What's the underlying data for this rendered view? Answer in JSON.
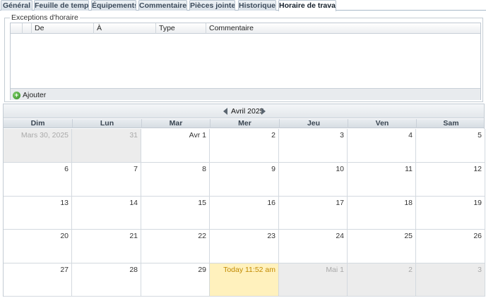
{
  "tabs": [
    {
      "label": "Général",
      "active": false
    },
    {
      "label": "Feuille de temps",
      "active": false
    },
    {
      "label": "Équipements",
      "active": false
    },
    {
      "label": "Commentaires",
      "active": false
    },
    {
      "label": "Pièces jointes",
      "active": false
    },
    {
      "label": "Historique",
      "active": false
    },
    {
      "label": "Horaire de travail",
      "active": true
    }
  ],
  "exceptions": {
    "legend": "Exceptions d'horaire",
    "columns": [
      "De",
      "À",
      "Type",
      "Commentaire"
    ],
    "rows": [],
    "add_label": "Ajouter",
    "add_icon": "add-icon"
  },
  "calendar": {
    "month_label": "Avril 2025",
    "weekdays": [
      "Dim",
      "Lun",
      "Mar",
      "Mer",
      "Jeu",
      "Ven",
      "Sam"
    ],
    "weeks": [
      [
        {
          "label": "Mars 30, 2025",
          "other": true
        },
        {
          "label": "31",
          "other": true
        },
        {
          "label": "Avr 1"
        },
        {
          "label": "2"
        },
        {
          "label": "3"
        },
        {
          "label": "4"
        },
        {
          "label": "5"
        }
      ],
      [
        {
          "label": "6"
        },
        {
          "label": "7"
        },
        {
          "label": "8"
        },
        {
          "label": "9"
        },
        {
          "label": "10"
        },
        {
          "label": "11"
        },
        {
          "label": "12"
        }
      ],
      [
        {
          "label": "13"
        },
        {
          "label": "14"
        },
        {
          "label": "15"
        },
        {
          "label": "16"
        },
        {
          "label": "17"
        },
        {
          "label": "18"
        },
        {
          "label": "19"
        }
      ],
      [
        {
          "label": "20"
        },
        {
          "label": "21"
        },
        {
          "label": "22"
        },
        {
          "label": "23"
        },
        {
          "label": "24"
        },
        {
          "label": "25"
        },
        {
          "label": "26"
        }
      ],
      [
        {
          "label": "27"
        },
        {
          "label": "28"
        },
        {
          "label": "29"
        },
        {
          "label": "Today 11:52 am",
          "today": true
        },
        {
          "label": "Mai 1",
          "other": true
        },
        {
          "label": "2",
          "other": true
        },
        {
          "label": "3",
          "other": true
        }
      ]
    ],
    "colors": {
      "today": "#fff1bd",
      "today_text": "#c28a00",
      "other_month": "#ececec"
    }
  }
}
